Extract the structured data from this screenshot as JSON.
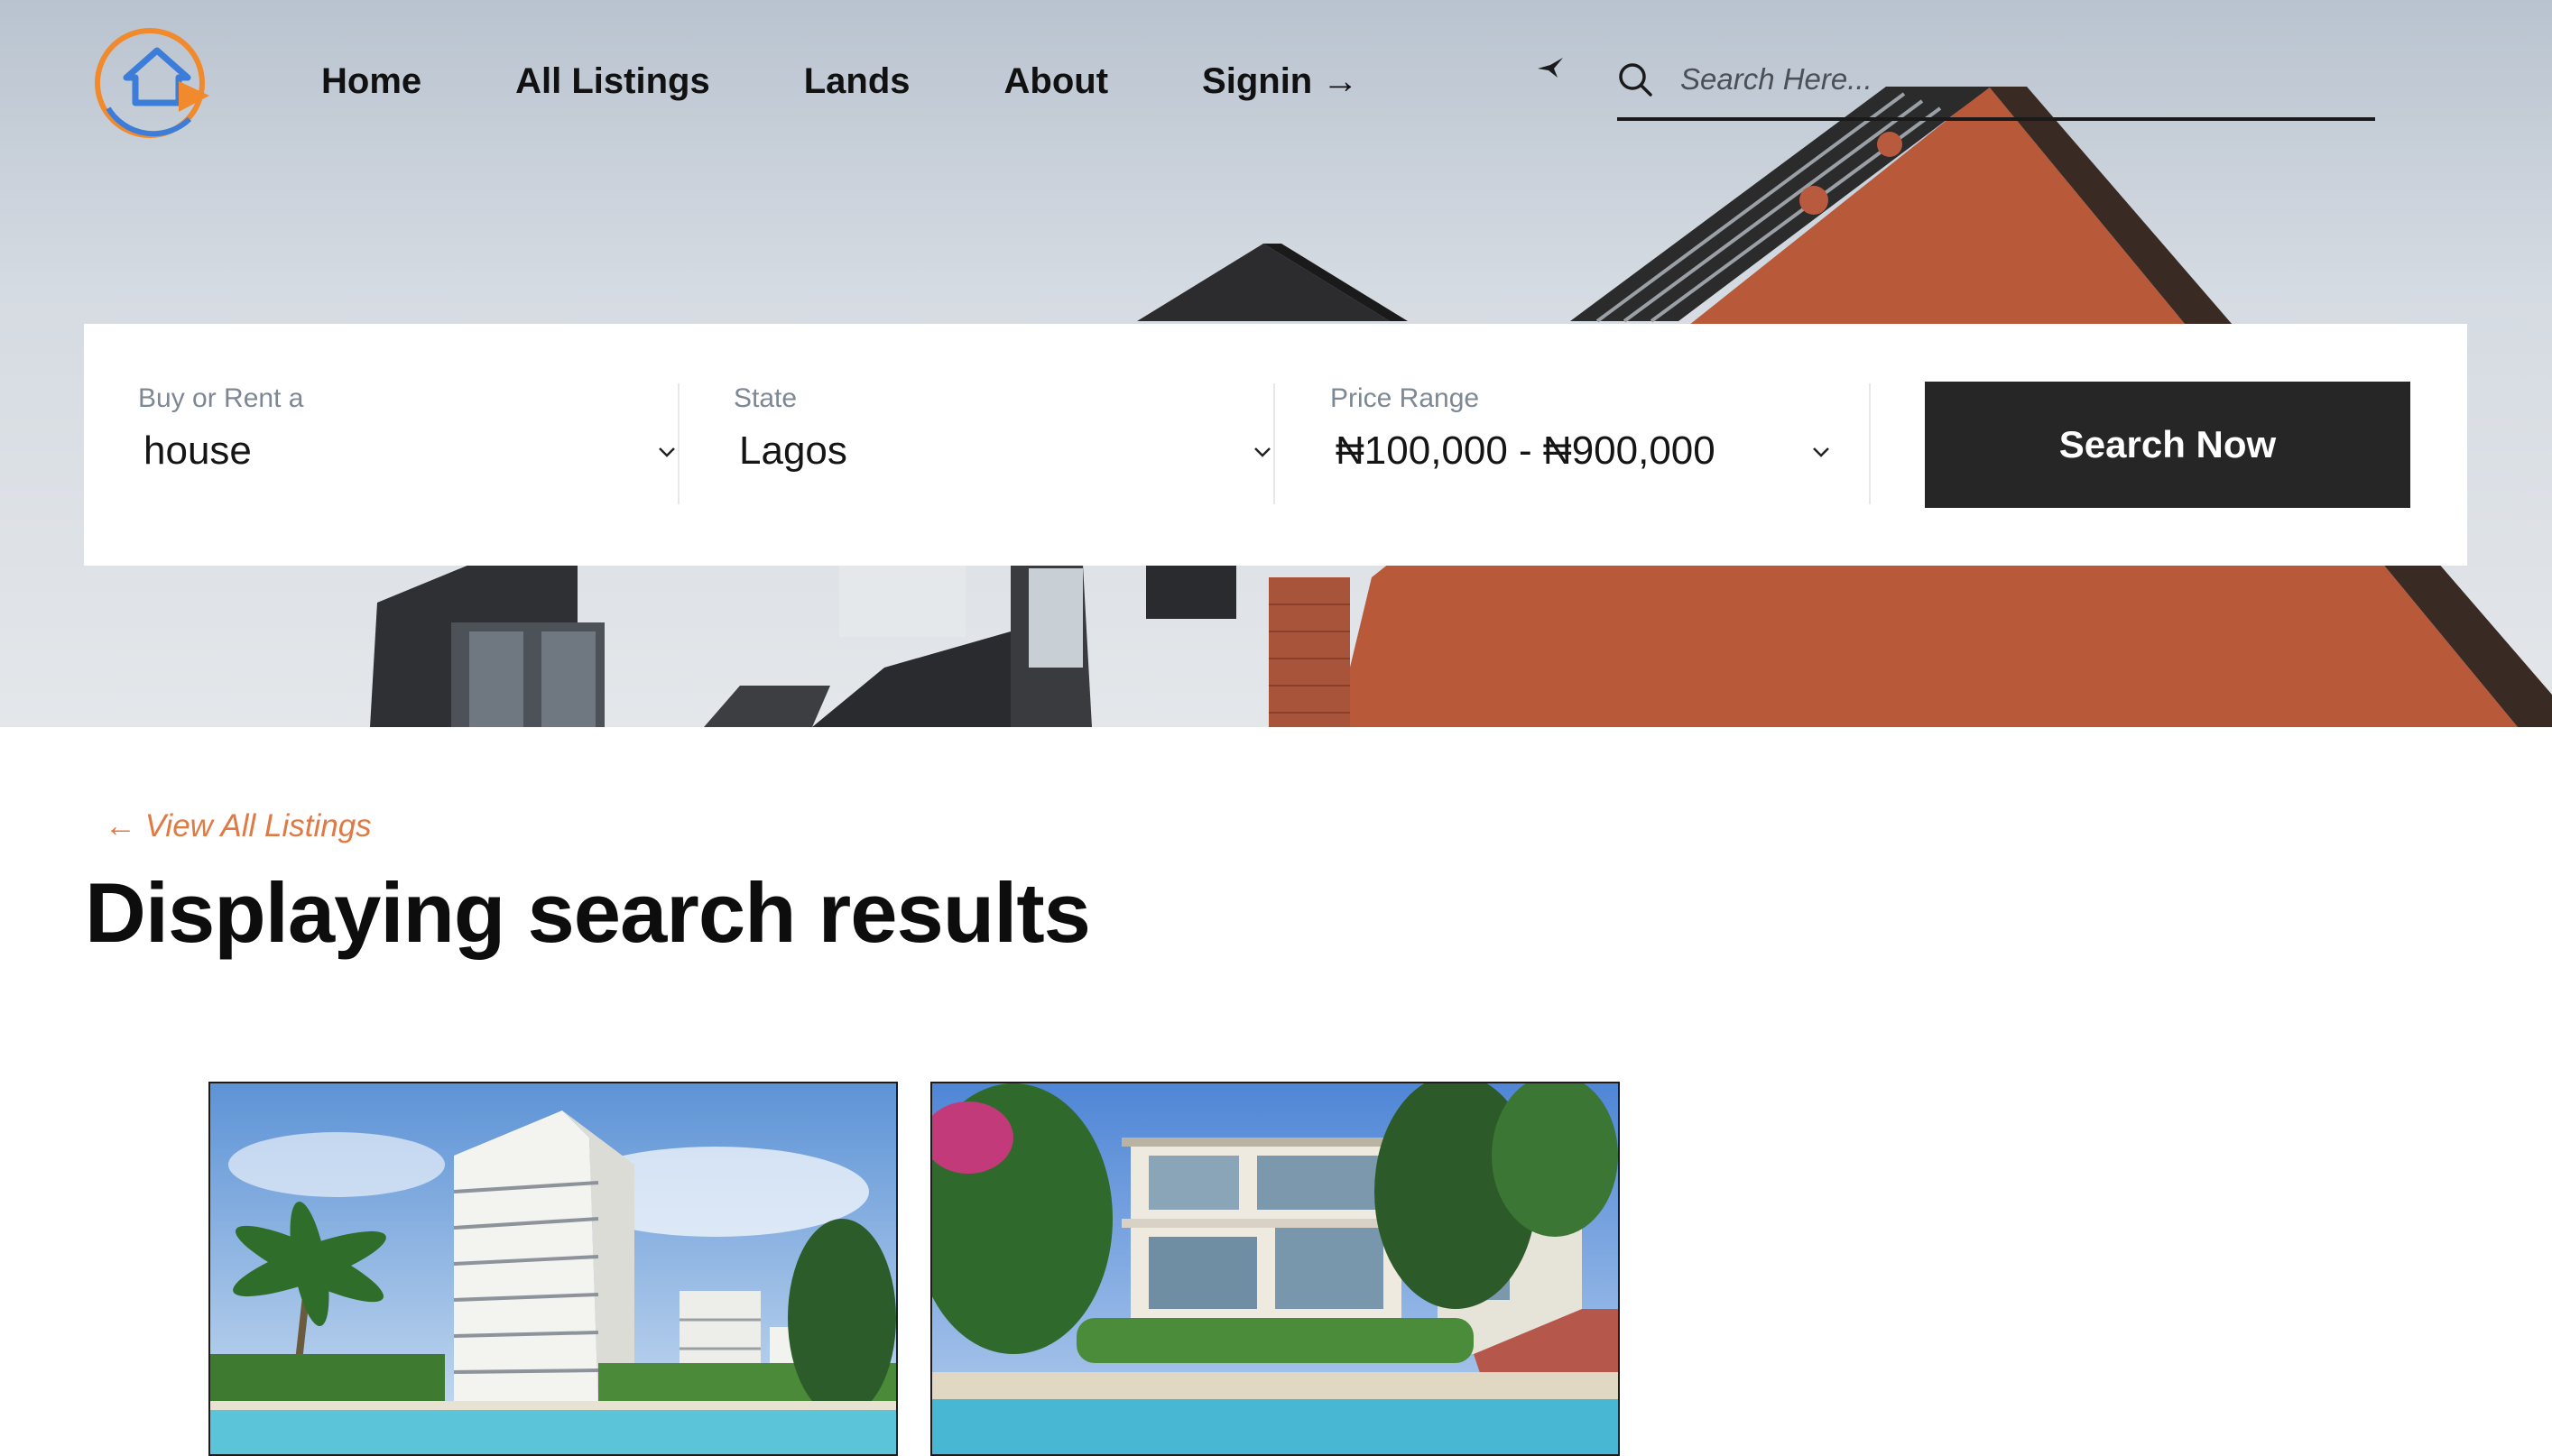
{
  "nav": {
    "home": "Home",
    "all_listings": "All Listings",
    "lands": "Lands",
    "about": "About",
    "signin": "Signin →"
  },
  "header_search": {
    "placeholder": "Search Here..."
  },
  "filters": {
    "buy_or_rent": {
      "label": "Buy or Rent a",
      "value": "house"
    },
    "state": {
      "label": "State",
      "value": "Lagos"
    },
    "price_range": {
      "label": "Price Range",
      "value": "₦100,000 - ₦900,000"
    },
    "search_button": "Search Now"
  },
  "results": {
    "back_link": "← View All Listings",
    "title": "Displaying search results"
  },
  "icons": {
    "logo": "house-arrow-logo",
    "search": "search-icon",
    "chevron": "chevron-down-icon"
  },
  "colors": {
    "accent": "#e07a45",
    "button_bg": "#262626",
    "logo_blue": "#3b7dd8",
    "logo_orange": "#f08a2c"
  }
}
